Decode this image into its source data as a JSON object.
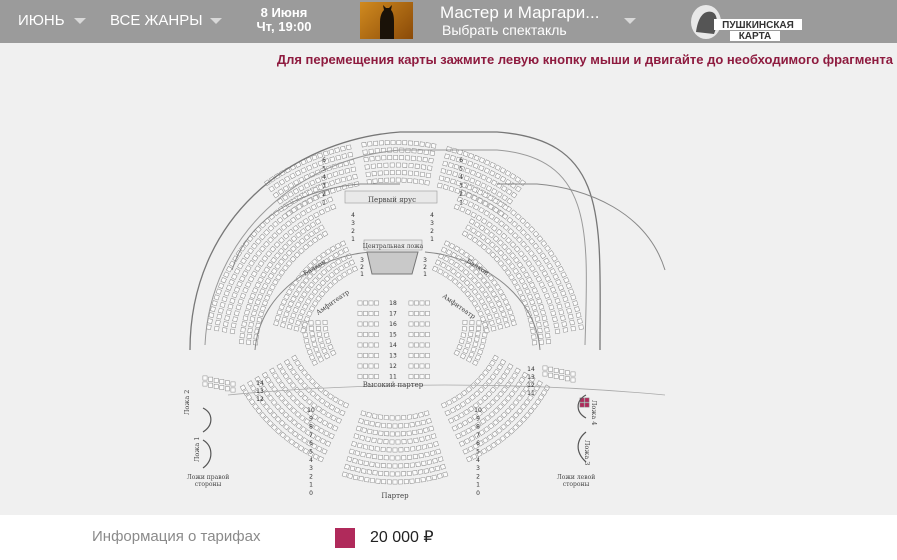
{
  "header": {
    "month": "ИЮНЬ",
    "genre": "ВСЕ ЖАНРЫ",
    "date_line1": "8 Июня",
    "date_line2": "Чт, 19:00",
    "performance_title": "Мастер и Маргари...",
    "performance_select": "Выбрать спектакль",
    "logo_line1": "ПУШКИНСКАЯ",
    "logo_line2": "КАРТА"
  },
  "hint": "Для перемещения карты зажмите левую кнопку мыши и двигайте до необходимого фрагмента",
  "hall": {
    "first_tier": "Первый ярус",
    "central_box": "Центральная ложа",
    "balcony_left": "Балкон",
    "balcony_right": "Балкон",
    "amphi_left": "Амфитеатр",
    "amphi_right": "Амфитеатр",
    "high_parterre": "Высокий партер",
    "parterre": "Партер",
    "box1": "Ложа 1",
    "box2": "Ложа 2",
    "box3": "Ложа 3",
    "box4": "Ложа 4",
    "boxes_right_side": "Ложи правой стороны",
    "boxes_left_side": "Ложи левой стороны",
    "center_rows": [
      "18",
      "17",
      "16",
      "15",
      "14",
      "13",
      "12",
      "11"
    ],
    "top_rows": [
      "6",
      "5",
      "4",
      "3",
      "2",
      "1"
    ],
    "tier_rows": [
      "4",
      "3",
      "2",
      "1"
    ],
    "balcony_rows": [
      "3",
      "2",
      "1"
    ],
    "hp_rows": [
      "14",
      "13",
      "12"
    ],
    "hp_rows_right": [
      "14",
      "13",
      "12",
      "11"
    ],
    "parterre_rows": [
      "10",
      "9",
      "8",
      "7",
      "6",
      "5",
      "4",
      "3",
      "2",
      "1",
      "0"
    ]
  },
  "tariffs": {
    "label": "Информация о тарифах",
    "items": [
      {
        "price": "20 000 ₽",
        "color": "#b02a5b"
      }
    ]
  },
  "colors": {
    "topbar": "#9b9b9b",
    "accent": "#8e1b3f",
    "selected_seat": "#b02a5b"
  }
}
